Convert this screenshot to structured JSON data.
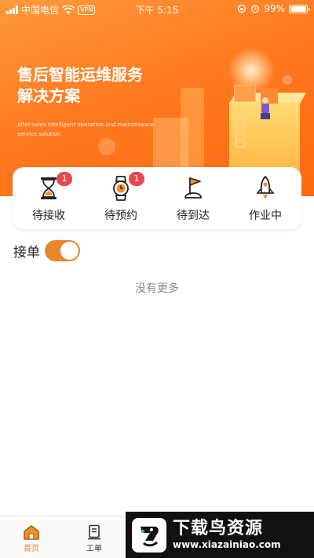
{
  "status_bar": {
    "carrier": "中国电信",
    "vpn": "VPN",
    "time": "下午 5:15",
    "battery": "99%",
    "battery_level": 0.99
  },
  "hero": {
    "title_line1": "售后智能运维服务",
    "title_line2": "解决方案",
    "subtitle": "After-sales intelligent operation and maintenance service solution"
  },
  "tabs": [
    {
      "label": "待接收",
      "badge": "1",
      "icon": "hourglass-icon"
    },
    {
      "label": "待预约",
      "badge": "1",
      "icon": "watch-icon"
    },
    {
      "label": "待到达",
      "badge": "",
      "icon": "flag-icon"
    },
    {
      "label": "作业中",
      "badge": "",
      "icon": "rocket-icon"
    }
  ],
  "accept_order": {
    "label": "接单",
    "enabled": true
  },
  "empty_message": "没有更多",
  "bottom_nav": [
    {
      "label": "首页",
      "icon": "home-icon",
      "active": true
    },
    {
      "label": "工单",
      "icon": "work-order-icon",
      "active": false
    }
  ],
  "watermark": {
    "title": "下载鸟资源",
    "url": "www.xiazainiao.com"
  },
  "colors": {
    "accent": "#e8862c",
    "hero_start": "#ff9a3c",
    "hero_end": "#ff6a12",
    "badge": "#e5484d"
  }
}
